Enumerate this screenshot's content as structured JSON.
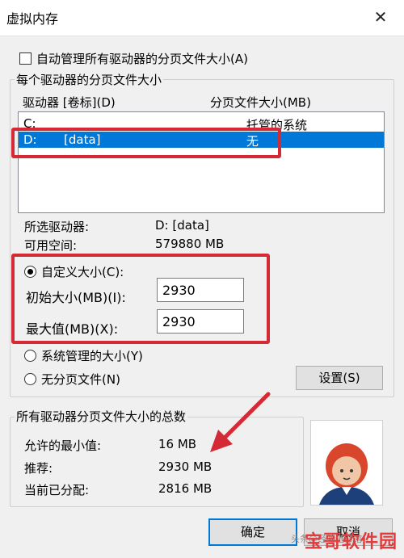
{
  "window": {
    "title": "虚拟内存",
    "close_glyph": "✕"
  },
  "auto_manage": {
    "label": "自动管理所有驱动器的分页文件大小(A)",
    "checked": false
  },
  "per_drive": {
    "group_title": "每个驱动器的分页文件大小",
    "header_drive": "驱动器 [卷标](D)",
    "header_size": "分页文件大小(MB)",
    "rows": [
      {
        "drive": "C:",
        "label": "",
        "size": "托管的系统",
        "selected": false
      },
      {
        "drive": "D:",
        "label": "[data]",
        "size": "无",
        "selected": true
      }
    ],
    "selected_drive_label": "所选驱动器:",
    "selected_drive_value": "D:  [data]",
    "free_space_label": "可用空间:",
    "free_space_value": "579880 MB",
    "custom_size_label": "自定义大小(C):",
    "initial_size_label": "初始大小(MB)(I):",
    "initial_size_value": "2930",
    "max_size_label": "最大值(MB)(X):",
    "max_size_value": "2930",
    "system_managed_label": "系统管理的大小(Y)",
    "no_paging_label": "无分页文件(N)",
    "set_button": "设置(S)",
    "selected_option": "custom"
  },
  "totals": {
    "group_title": "所有驱动器分页文件大小的总数",
    "min_label": "允许的最小值:",
    "min_value": "16 MB",
    "recommended_label": "推荐:",
    "recommended_value": "2930 MB",
    "allocated_label": "当前已分配:",
    "allocated_value": "2816 MB"
  },
  "buttons": {
    "ok": "确定",
    "cancel": "取消"
  },
  "watermark": {
    "brand": "宝哥软件园",
    "small_text": "头条@经验进修馆"
  },
  "colors": {
    "selection": "#0078d7",
    "annotation_red": "#d42a36",
    "primary_border": "#0078d7"
  }
}
